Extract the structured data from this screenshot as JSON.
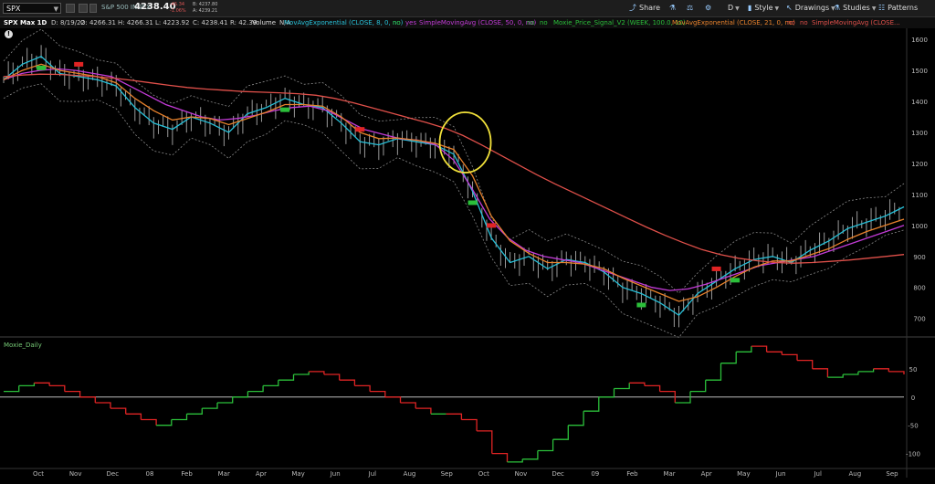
{
  "toolbar": {
    "symbol": "SPX",
    "index_name": "S&P 500 INDEX",
    "last_price": "4238.40",
    "change_abs": "-45.34",
    "change_pct": "-1.06%",
    "bid": "B: 4237.80",
    "ask": "A: 4239.21",
    "share_label": "Share",
    "timeframe_label": "D",
    "style_label": "Style",
    "drawings_label": "Drawings",
    "studies_label": "Studies",
    "patterns_label": "Patterns"
  },
  "infobar": {
    "title": "SPX Max 1D",
    "date": "D: 8/19/22",
    "open": "O: 4266.31",
    "high": "H: 4266.31",
    "low": "L: 4223.92",
    "close": "C: 4238.41",
    "range": "R: 42.39",
    "volume": "Volume",
    "na": "N/A",
    "study1": "MovAvgExponential (CLOSE, 8, 0, no)",
    "study1_flag": "no",
    "study1_yes": "yes",
    "study2": "SimpleMovingAvg (CLOSE, 50, 0, no)",
    "study2_flag1": "no",
    "study2_flag2": "no",
    "study3": "Moxie_Price_Signal_V2 (WEEK, 100.0, 10)",
    "study3_flag": "no",
    "study4": "MovAvgExponential (CLOSE, 21, 0, no)",
    "study4_flag1": "no",
    "study4_flag2": "no",
    "study5": "SimpleMovingAvg (CLOSE..."
  },
  "lower_panel": {
    "label": "Moxie_Daily"
  },
  "colors": {
    "ema8": "#27c0d8",
    "sma50": "#c23bd6",
    "ema21": "#e8822c",
    "sma200": "#e0504a",
    "bars": "#9a9a9a",
    "envelope": "#888888",
    "moxie_up": "#2bbf3a",
    "moxie_down": "#e02424",
    "highlight": "#f2e23a"
  },
  "chart_data": [
    {
      "type": "line",
      "panel": "price",
      "x_labels": [
        "Oct",
        "Nov",
        "Dec",
        "08",
        "Feb",
        "Mar",
        "Apr",
        "May",
        "Jun",
        "Jul",
        "Aug",
        "Sep",
        "Oct",
        "Nov",
        "Dec",
        "09",
        "Feb",
        "Mar",
        "Apr",
        "May",
        "Jun",
        "Jul",
        "Aug",
        "Sep"
      ],
      "y_ticks": [
        700,
        800,
        900,
        1000,
        1100,
        1200,
        1300,
        1400,
        1500,
        1600
      ],
      "ylim": [
        640,
        1630
      ],
      "series": [
        {
          "values": [
            1470,
            1520,
            1545,
            1490,
            1480,
            1470,
            1450,
            1380,
            1330,
            1310,
            1350,
            1330,
            1300,
            1360,
            1380,
            1410,
            1390,
            1380,
            1330,
            1270,
            1260,
            1280,
            1270,
            1260,
            1230,
            1110,
            960,
            880,
            900,
            860,
            890,
            880,
            850,
            800,
            780,
            750,
            710,
            780,
            820,
            860,
            890,
            900,
            880,
            920,
            950,
            990,
            1010,
            1030,
            1060
          ]
        },
        {
          "values": [
            1470,
            1490,
            1500,
            1505,
            1500,
            1490,
            1480,
            1450,
            1420,
            1390,
            1370,
            1350,
            1340,
            1345,
            1355,
            1370,
            1380,
            1385,
            1370,
            1340,
            1310,
            1295,
            1280,
            1275,
            1260,
            1210,
            1120,
            1020,
            960,
            920,
            900,
            890,
            880,
            860,
            840,
            820,
            800,
            790,
            795,
            810,
            830,
            850,
            870,
            880,
            890,
            900,
            920,
            940,
            960,
            980,
            1000
          ]
        },
        {
          "values": [
            1470,
            1500,
            1520,
            1500,
            1490,
            1480,
            1460,
            1410,
            1370,
            1340,
            1350,
            1345,
            1325,
            1345,
            1365,
            1390,
            1390,
            1385,
            1350,
            1300,
            1280,
            1282,
            1275,
            1265,
            1245,
            1160,
            1030,
            950,
            910,
            880,
            880,
            875,
            860,
            830,
            805,
            780,
            755,
            770,
            800,
            835,
            865,
            885,
            885,
            905,
            925,
            955,
            980,
            1000,
            1020
          ]
        },
        {
          "values": [
            1480,
            1485,
            1488,
            1487,
            1484,
            1480,
            1475,
            1468,
            1460,
            1452,
            1445,
            1440,
            1436,
            1432,
            1430,
            1428,
            1425,
            1420,
            1410,
            1396,
            1380,
            1364,
            1348,
            1332,
            1314,
            1290,
            1260,
            1228,
            1196,
            1164,
            1134,
            1106,
            1078,
            1050,
            1022,
            994,
            968,
            944,
            922,
            906,
            894,
            886,
            880,
            878,
            880,
            884,
            888,
            894,
            900,
            906
          ]
        }
      ],
      "annotations": {
        "sell_signals": [
          {
            "x": 4
          },
          {
            "x": 19
          },
          {
            "x": 26
          },
          {
            "x": 38
          }
        ],
        "buy_signals": [
          {
            "x": 2
          },
          {
            "x": 15
          },
          {
            "x": 25
          },
          {
            "x": 34
          },
          {
            "x": 39
          }
        ],
        "highlight_ellipse_center_x": 25
      }
    },
    {
      "type": "line",
      "panel": "moxie",
      "y_ticks": [
        50,
        0,
        -50,
        -100
      ],
      "ylim": [
        -120,
        95
      ],
      "values": [
        10,
        20,
        25,
        20,
        10,
        0,
        -10,
        -20,
        -30,
        -40,
        -50,
        -40,
        -30,
        -20,
        -10,
        0,
        10,
        20,
        30,
        40,
        45,
        40,
        30,
        20,
        10,
        0,
        -10,
        -20,
        -30,
        -30,
        -40,
        -60,
        -100,
        -115,
        -110,
        -95,
        -75,
        -50,
        -25,
        0,
        15,
        25,
        20,
        10,
        -10,
        10,
        30,
        60,
        80,
        90,
        80,
        75,
        65,
        50,
        35,
        40,
        45,
        50,
        45,
        40
      ]
    }
  ]
}
